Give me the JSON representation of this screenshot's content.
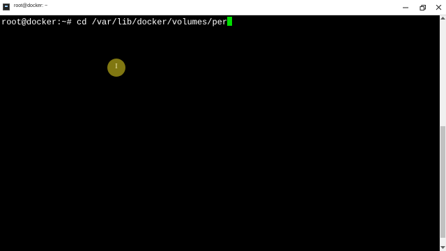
{
  "window": {
    "title": "root@docker: ~"
  },
  "terminal": {
    "prompt": "root@docker:~# ",
    "command": "cd /var/lib/docker/volumes/per",
    "cursor_color": "#00e000"
  },
  "mouse_indicator": {
    "glyph": "I"
  },
  "scrollbar": {
    "thumb_position": 0.47,
    "thumb_size": 0.5
  },
  "icons": {
    "app": "terminal-icon",
    "minimize": "minimize-icon",
    "maximize": "maximize-icon",
    "close": "close-icon"
  },
  "colors": {
    "background": "#000000",
    "text": "#ffffff",
    "titlebar": "#ffffff"
  }
}
